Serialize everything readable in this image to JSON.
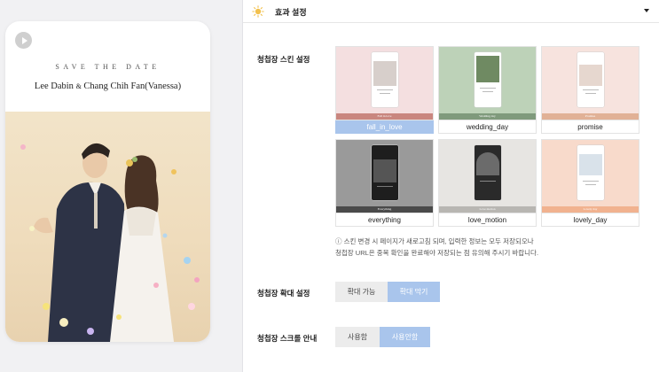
{
  "preview": {
    "save_the_date": "SAVE THE DATE",
    "groom_name": "Lee Dabin",
    "amp": "&",
    "bride_name": "Chang Chih Fan(Vanessa)"
  },
  "header": {
    "title": "효과 설정"
  },
  "skin": {
    "label": "청첩장 스킨 설정",
    "options": [
      {
        "name": "fall_in_love",
        "band_text": "Fall in love",
        "selected": true,
        "bg": "#f4dfe0",
        "band": "#c9867f"
      },
      {
        "name": "wedding_day",
        "band_text": "Wedding day",
        "selected": false,
        "bg": "#bdd2b8",
        "band": "#7f9a7c"
      },
      {
        "name": "promise",
        "band_text": "Promise",
        "selected": false,
        "bg": "#f7e3de",
        "band": "#e1b196"
      },
      {
        "name": "everything",
        "band_text": "Everything",
        "selected": false,
        "bg": "#9a9a9a",
        "band": "#4a4a4a"
      },
      {
        "name": "love_motion",
        "band_text": "Love motion",
        "selected": false,
        "bg": "#e7e5e2",
        "band": "#b8b6b2"
      },
      {
        "name": "lovely_day",
        "band_text": "Lovely day",
        "selected": false,
        "bg": "#f8dacb",
        "band": "#f1b28f"
      }
    ],
    "notice_line1": "ⓘ 스킨 변경 시 페이지가 새로고침 되며, 입력한 정보는 모두 저장되오나",
    "notice_line2": "청첩장 URL은 중복 확인을 완료해야 저장되는 점 유의해 주시기 바랍니다."
  },
  "zoom": {
    "label": "청첩장 확대 설정",
    "allow_label": "확대 가능",
    "block_label": "확대 막기",
    "selected": "block"
  },
  "scroll_guide": {
    "label": "청첩장 스크롤 안내",
    "use_label": "사용함",
    "nouse_label": "사용안함",
    "selected": "nouse"
  },
  "colors": {
    "accent": "#a9c5ec"
  }
}
